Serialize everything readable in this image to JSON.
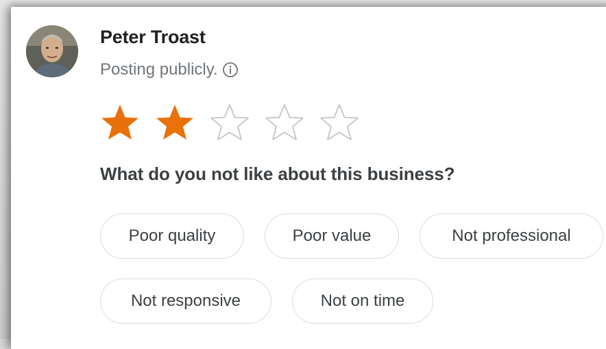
{
  "user": {
    "name": "Peter Troast",
    "posting_status": "Posting publicly.",
    "avatar_icon": "user-avatar-photo",
    "info_icon": "info-icon"
  },
  "rating": {
    "value": 2,
    "max": 5,
    "filled_color": "#e8710a",
    "empty_color": "#c9c9c9"
  },
  "question": "What do you not like about this business?",
  "options": [
    {
      "label": "Poor quality"
    },
    {
      "label": "Poor value"
    },
    {
      "label": "Not professional"
    },
    {
      "label": "Not responsive"
    },
    {
      "label": "Not on time"
    }
  ]
}
